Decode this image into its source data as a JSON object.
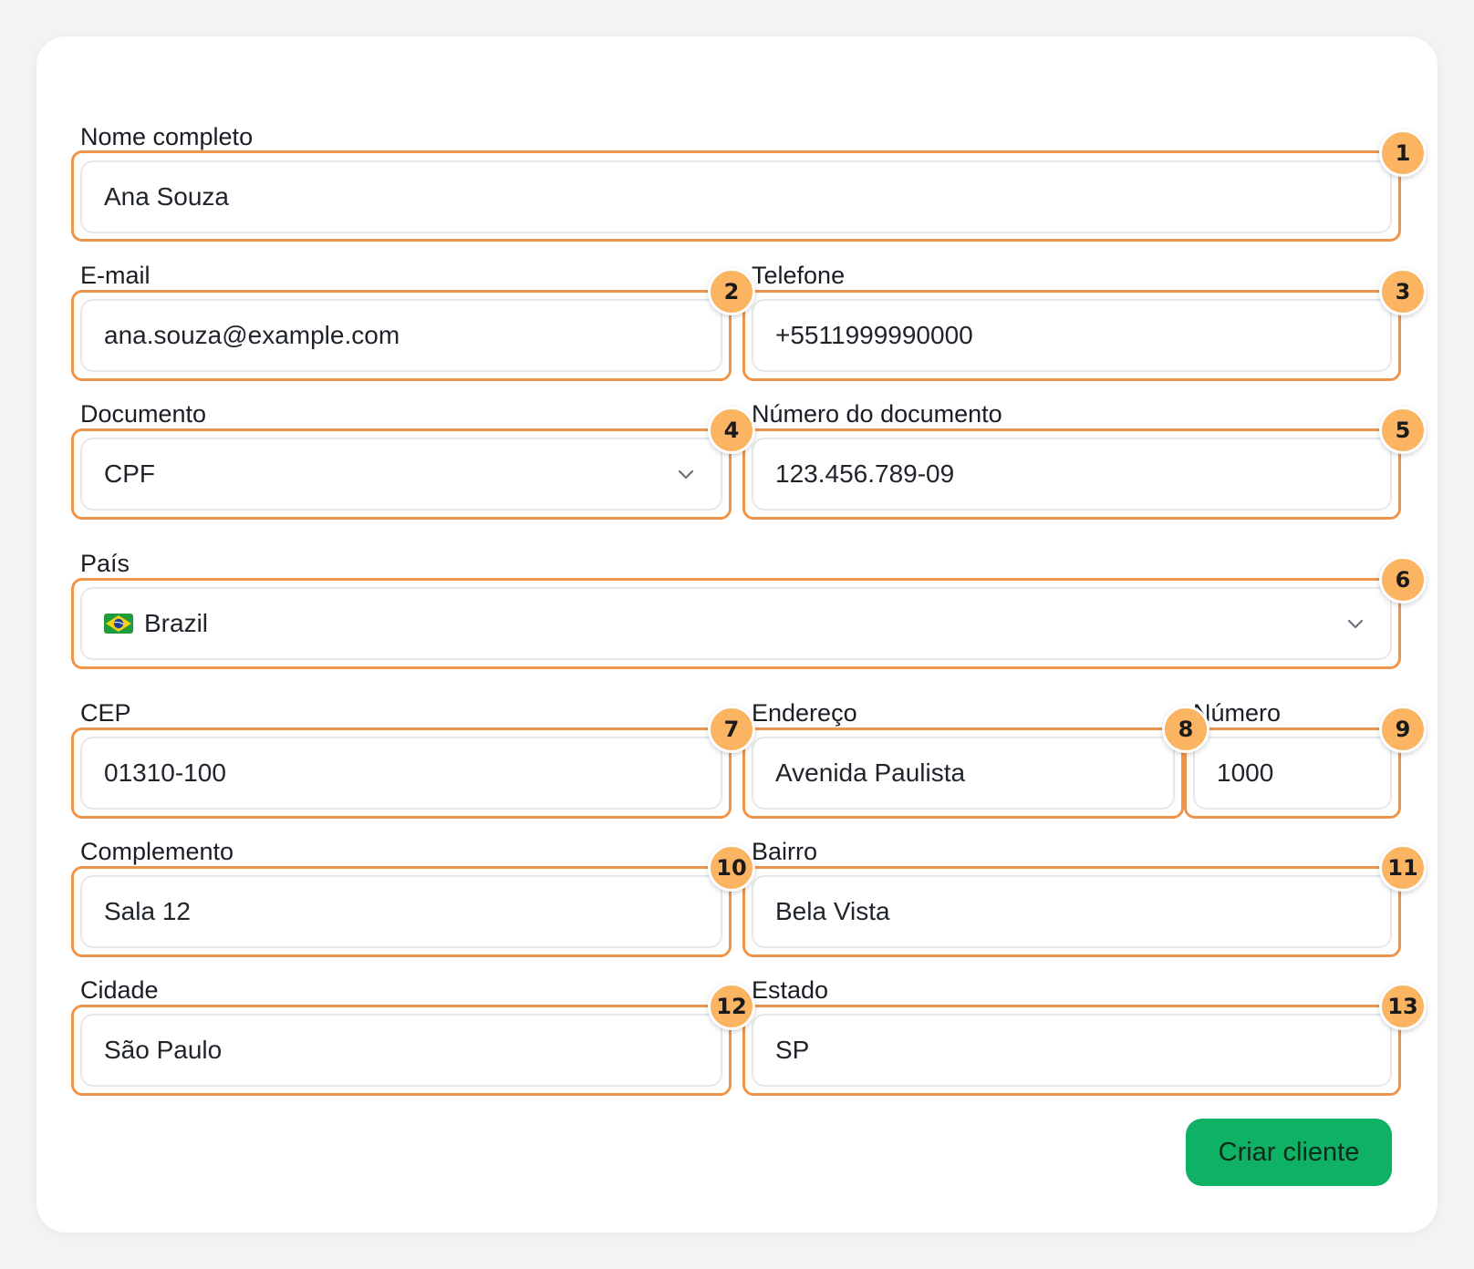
{
  "form": {
    "full_name": {
      "label": "Nome completo",
      "value": "Ana Souza",
      "badge": "1"
    },
    "email": {
      "label": "E-mail",
      "value": "ana.souza@example.com",
      "badge": "2"
    },
    "phone": {
      "label": "Telefone",
      "value": "+5511999990000",
      "badge": "3"
    },
    "document_type": {
      "label": "Documento",
      "value": "CPF",
      "badge": "4",
      "icon": "chevron-down-icon"
    },
    "document_number": {
      "label": "Número do documento",
      "value": "123.456.789-09",
      "badge": "5"
    },
    "country": {
      "label": "País",
      "value": "Brazil",
      "badge": "6",
      "flag_icon": "brazil-flag-icon",
      "icon": "chevron-down-icon"
    },
    "cep": {
      "label": "CEP",
      "value": "01310-100",
      "badge": "7"
    },
    "address": {
      "label": "Endereço",
      "value": "Avenida Paulista",
      "badge": "8"
    },
    "number": {
      "label": "Número",
      "value": "1000",
      "badge": "9"
    },
    "complement": {
      "label": "Complemento",
      "value": "Sala 12",
      "badge": "10"
    },
    "neighborhood": {
      "label": "Bairro",
      "value": "Bela Vista",
      "badge": "11"
    },
    "city": {
      "label": "Cidade",
      "value": "São Paulo",
      "badge": "12"
    },
    "state": {
      "label": "Estado",
      "value": "SP",
      "badge": "13"
    }
  },
  "actions": {
    "submit_label": "Criar cliente"
  },
  "colors": {
    "highlight": "#f0944a",
    "badge": "#fbb462",
    "button": "#0fb164",
    "background": "#f2f3f5"
  }
}
